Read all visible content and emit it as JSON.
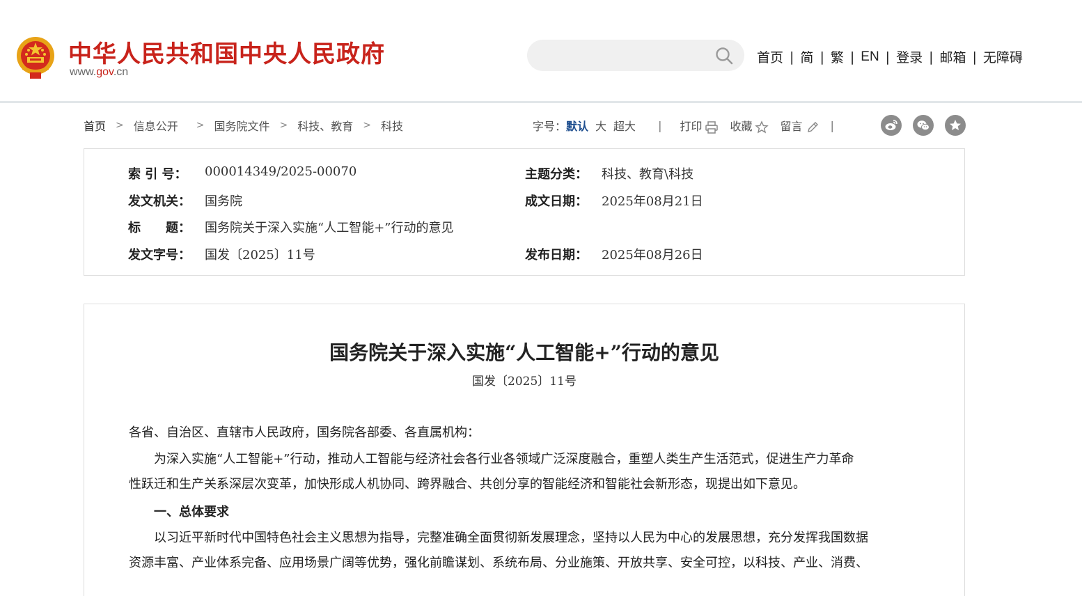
{
  "header": {
    "site_title": "中华人民共和国中央人民政府",
    "url_prefix": "www.",
    "url_mid": "gov",
    "url_suffix": ".cn",
    "search": {
      "placeholder": ""
    },
    "nav": [
      "首页",
      "简",
      "繁",
      "EN",
      "登录",
      "邮箱",
      "无障碍"
    ]
  },
  "breadcrumb": [
    "首页",
    "信息公开",
    "国务院文件",
    "科技、教育",
    "科技"
  ],
  "toolbar": {
    "font_size_label": "字号：",
    "font_default": "默认",
    "font_large": "大",
    "font_xlarge": "超大",
    "print": "打印",
    "favorite": "收藏",
    "comment": "留言"
  },
  "meta": {
    "index_label": "索 引 号：",
    "index_value": "000014349/2025-00070",
    "topic_label": "主题分类：",
    "topic_value": "科技、教育\\科技",
    "issuer_label": "发文机关：",
    "issuer_value": "国务院",
    "written_label": "成文日期：",
    "written_value": "2025年08月21日",
    "title_label": "标　　题：",
    "title_value": "国务院关于深入实施“人工智能+”行动的意见",
    "docno_label": "发文字号：",
    "docno_value": "国发〔2025〕11号",
    "published_label": "发布日期：",
    "published_value": "2025年08月26日"
  },
  "document": {
    "title": "国务院关于深入实施“人工智能+”行动的意见",
    "number": "国发〔2025〕11号",
    "salutation": "各省、自治区、直辖市人民政府，国务院各部委、各直属机构：",
    "intro_line1": "　　为深入实施“人工智能+”行动，推动人工智能与经济社会各行业各领域广泛深度融合，重塑人类生产生活范式，促进生产力革命",
    "intro_line2": "性跃迁和生产关系深层次变革，加快形成人机协同、跨界融合、共创分享的智能经济和智能社会新形态，现提出如下意见。",
    "section1_heading": "　　一、总体要求",
    "section1_line1": "　　以习近平新时代中国特色社会主义思想为指导，完整准确全面贯彻新发展理念，坚持以人民为中心的发展思想，充分发挥我国数据",
    "section1_line2": "资源丰富、产业体系完备、应用场景广阔等优势，强化前瞻谋划、系统布局、分业施策、开放共享、安全可控，以科技、产业、消费、"
  },
  "colors": {
    "brand_red": "#c8231b",
    "active_blue": "#1f4f8f",
    "share_gray": "#8c8c8c"
  }
}
